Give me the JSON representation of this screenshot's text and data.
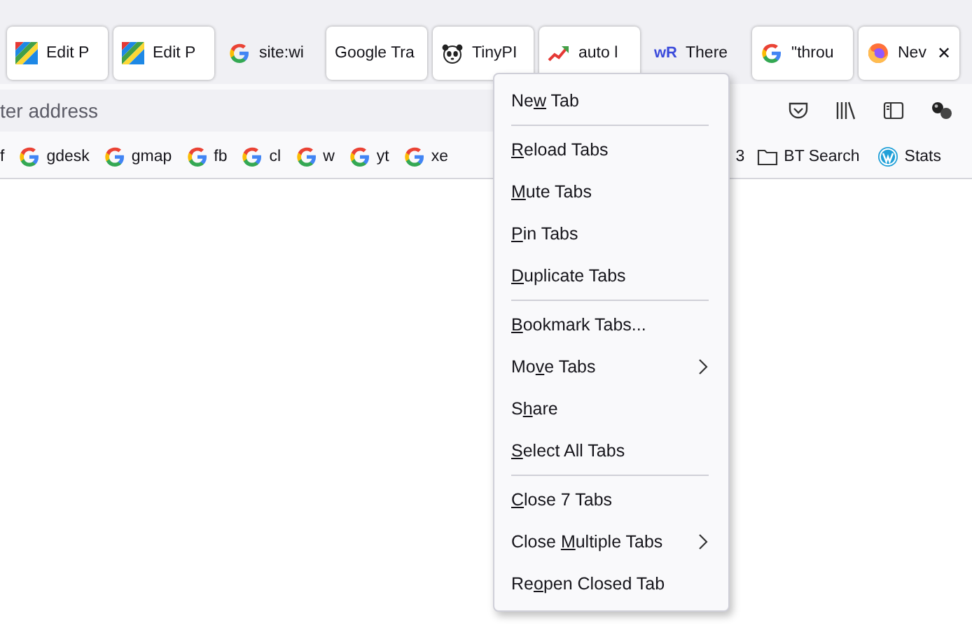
{
  "tabs": [
    {
      "label": "Edit P",
      "kind": "stripes",
      "selected": true,
      "closable": false
    },
    {
      "label": "Edit P",
      "kind": "stripes",
      "selected": true,
      "closable": false
    },
    {
      "label": "site:wi",
      "kind": "google",
      "selected": false,
      "closable": false
    },
    {
      "label": "Google Tra",
      "kind": "none",
      "selected": true,
      "closable": false
    },
    {
      "label": "TinyPI",
      "kind": "panda",
      "selected": true,
      "closable": false
    },
    {
      "label": "auto l",
      "kind": "trend",
      "selected": true,
      "closable": false
    },
    {
      "label": "There",
      "kind": "wr",
      "logo": "wR",
      "selected": false,
      "closable": false
    },
    {
      "label": "\"throu",
      "kind": "google",
      "selected": true,
      "closable": false
    },
    {
      "label": "Nev",
      "kind": "firefox",
      "selected": true,
      "closable": true,
      "close_glyph": "✕"
    }
  ],
  "address_bar": {
    "placeholder": "ter address"
  },
  "bookmarks_left": [
    {
      "label": "f",
      "kind": "none"
    },
    {
      "label": "gdesk",
      "kind": "google"
    },
    {
      "label": "gmap",
      "kind": "google"
    },
    {
      "label": "fb",
      "kind": "google"
    },
    {
      "label": "cl",
      "kind": "google"
    },
    {
      "label": "w",
      "kind": "google"
    },
    {
      "label": "yt",
      "kind": "google"
    },
    {
      "label": "xe",
      "kind": "google"
    }
  ],
  "bookmarks_right": [
    {
      "label": "3",
      "kind": "none"
    },
    {
      "label": "BT Search",
      "kind": "folder"
    },
    {
      "label": "Stats",
      "kind": "wordpress"
    }
  ],
  "context_menu": [
    {
      "kind": "item",
      "pre": "Ne",
      "key": "w",
      "post": " Tab",
      "submenu": false
    },
    {
      "kind": "separator"
    },
    {
      "kind": "item",
      "key": "R",
      "post": "eload Tabs",
      "submenu": false
    },
    {
      "kind": "item",
      "key": "M",
      "post": "ute Tabs",
      "submenu": false
    },
    {
      "kind": "item",
      "key": "P",
      "post": "in Tabs",
      "submenu": false
    },
    {
      "kind": "item",
      "key": "D",
      "post": "uplicate Tabs",
      "submenu": false
    },
    {
      "kind": "separator"
    },
    {
      "kind": "item",
      "key": "B",
      "post": "ookmark Tabs...",
      "submenu": false
    },
    {
      "kind": "item",
      "pre": "Mo",
      "key": "v",
      "post": "e Tabs",
      "submenu": true
    },
    {
      "kind": "item",
      "pre": "S",
      "key": "h",
      "post": "are",
      "submenu": false
    },
    {
      "kind": "item",
      "key": "S",
      "post": "elect All Tabs",
      "submenu": false
    },
    {
      "kind": "separator"
    },
    {
      "kind": "item",
      "key": "C",
      "post": "lose 7 Tabs",
      "submenu": false
    },
    {
      "kind": "item",
      "pre": "Close ",
      "key": "M",
      "post": "ultiple Tabs",
      "submenu": true
    },
    {
      "kind": "item",
      "pre": "Re",
      "key": "o",
      "post": "pen Closed Tab",
      "submenu": false
    }
  ]
}
